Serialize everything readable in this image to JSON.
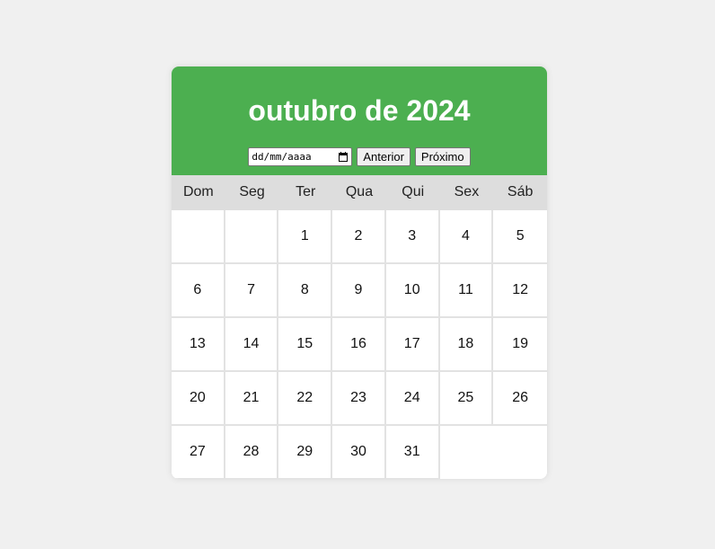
{
  "header": {
    "title": "outubro de 2024",
    "date_placeholder": "dd/mm/aaaa",
    "prev_label": "Anterior",
    "next_label": "Próximo",
    "calendar_icon": "calendar-icon"
  },
  "weekdays": [
    "Dom",
    "Seg",
    "Ter",
    "Qua",
    "Qui",
    "Sex",
    "Sáb"
  ],
  "days": [
    "",
    "",
    "1",
    "2",
    "3",
    "4",
    "5",
    "6",
    "7",
    "8",
    "9",
    "10",
    "11",
    "12",
    "13",
    "14",
    "15",
    "16",
    "17",
    "18",
    "19",
    "20",
    "21",
    "22",
    "23",
    "24",
    "25",
    "26",
    "27",
    "28",
    "29",
    "30",
    "31"
  ],
  "colors": {
    "header_bg": "#4caf50",
    "weekday_bg": "#dddddd",
    "page_bg": "#f0f0f0"
  }
}
